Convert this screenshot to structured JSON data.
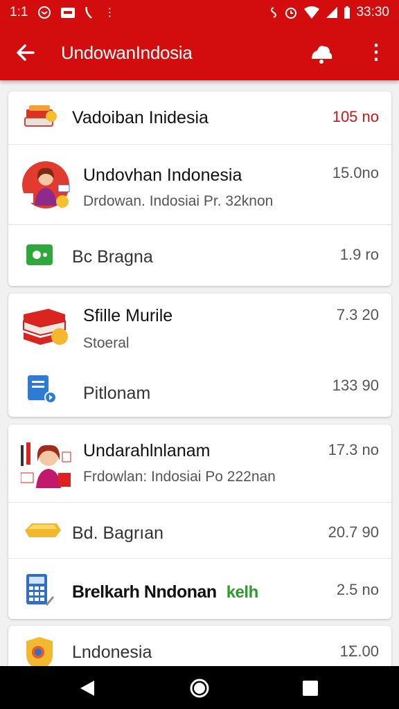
{
  "status_bar": {
    "time_left": "1:1",
    "time_right": "33:30",
    "left_icons": [
      "message-icon",
      "notification-box-icon",
      "phone-icon",
      "dot-icon"
    ],
    "right_icons": [
      "signal-icon",
      "alarm-icon",
      "wifi-icon",
      "cell-signal-icon",
      "battery-icon"
    ]
  },
  "app_bar": {
    "back_icon": "arrow-back-icon",
    "title": "UndowanIndosia",
    "action_icon": "cloud-bell-icon",
    "menu_icon": "more-vert-icon"
  },
  "cards": [
    {
      "rows": [
        {
          "icon": "stacked-books-icon",
          "title": "Vadoiban Inidesia",
          "amount": "105 no",
          "amount_color": "#d51010"
        },
        {
          "icon": "woman-avatar-icon",
          "title": "Undovhan Indonesia",
          "subtitle": "Drdowan. Indosiai Pr. 32knon",
          "amount": "15.0no"
        },
        {
          "icon": "green-chat-icon",
          "title": "Bc Bragna",
          "amount": "1.9 ro"
        }
      ]
    },
    {
      "rows": [
        {
          "icon": "red-book-coin-icon",
          "title": "Sfille Murile",
          "subtitle": "Stoeral",
          "amount": "7.3 20"
        },
        {
          "icon": "blue-document-icon",
          "title": "Pitlonam",
          "amount": "133 90"
        }
      ]
    },
    {
      "rows": [
        {
          "icon": "woman-tools-icon",
          "title": "Undarahlnlanam",
          "subtitle": "Frdowlan: Indosiai Po 222nan",
          "amount": "17.3 no"
        },
        {
          "icon": "gold-bars-icon",
          "title": "Bd. Bagrıan",
          "amount": "20.7 90"
        },
        {
          "icon": "calculator-icon",
          "title": "Brelkarh Nndonan",
          "tag": "kelh",
          "amount": "2.5 no"
        }
      ]
    },
    {
      "rows": [
        {
          "icon": "shield-badge-icon",
          "title": "Lndonesia",
          "amount": "1Σ.00"
        }
      ]
    }
  ],
  "nav_bar": {
    "back": "triangle-back-icon",
    "home": "home-circle-icon",
    "recents": "square-recents-icon"
  }
}
